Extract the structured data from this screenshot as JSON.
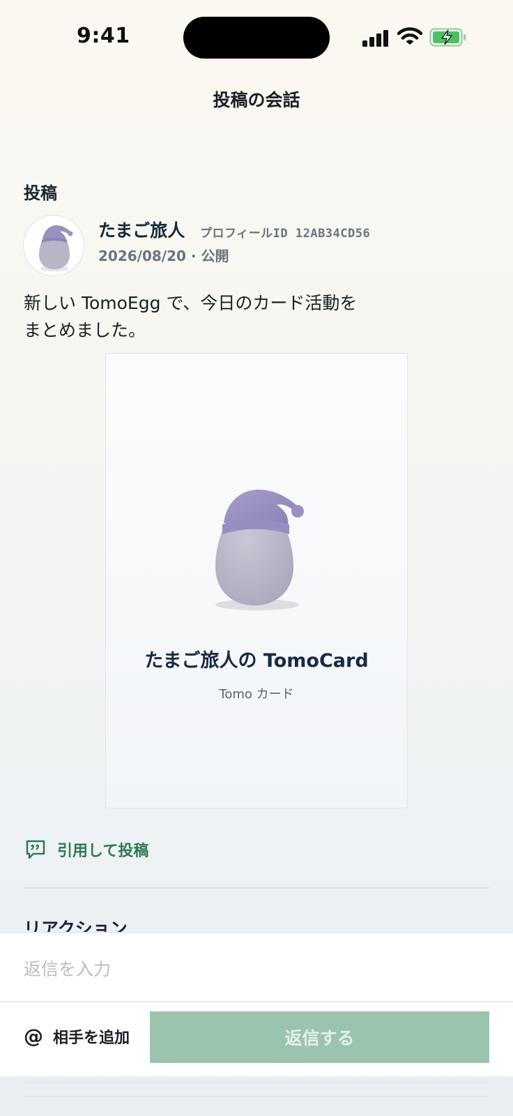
{
  "status_bar": {
    "time": "9:41"
  },
  "header": {
    "title": "投稿の会話"
  },
  "post_section": {
    "label": "投稿"
  },
  "post": {
    "author_name": "たまご旅人",
    "profile_id": "プロフィールID 12AB34CD56",
    "meta": "2026/08/20 · 公開",
    "body": "新しい TomoEgg で、今日のカード活動を\nまとめました。",
    "card": {
      "title": "たまご旅人の TomoCard",
      "subtitle": "Tomo カード"
    }
  },
  "actions": {
    "quote_label": "引用して投稿"
  },
  "reactions_section": {
    "label": "リアクション"
  },
  "composer": {
    "placeholder": "返信を入力",
    "mention_symbol": "@",
    "mention_label": "相手を追加",
    "send_label": "返信する"
  },
  "colors": {
    "accent_green": "#2f7a56",
    "send_disabled": "#9bc4ae",
    "egg": "#b7b5c6",
    "hat": "#9a90bf"
  },
  "icons": [
    "signal-icon",
    "wifi-icon",
    "battery-charging-icon",
    "quote-bubble-icon",
    "egg-character-icon"
  ]
}
